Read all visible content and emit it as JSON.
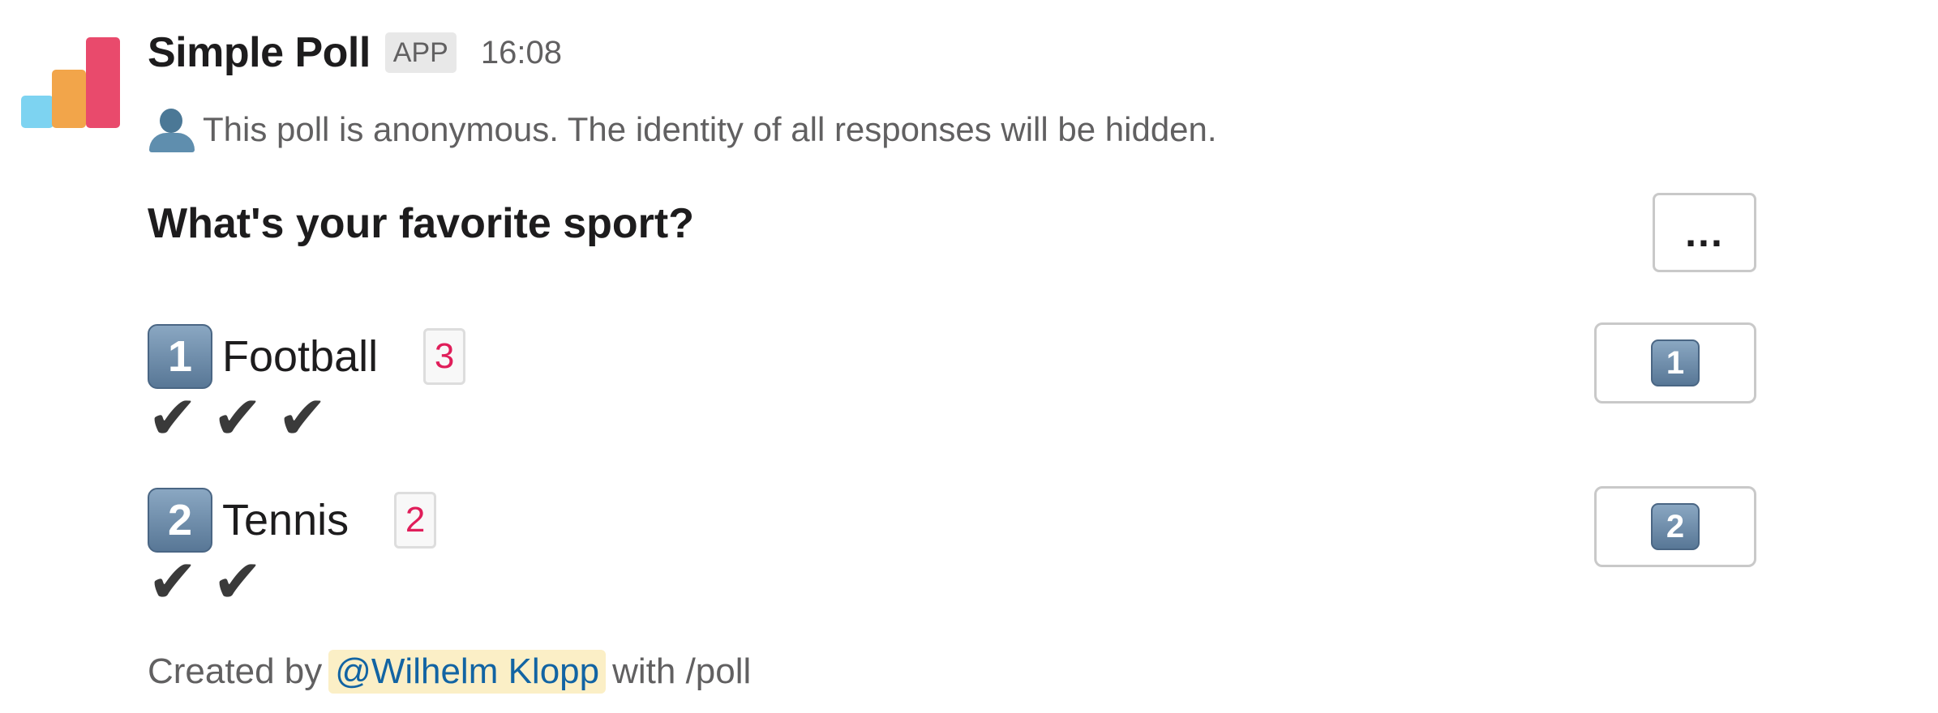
{
  "app": {
    "name": "Simple Poll",
    "badge": "APP",
    "timestamp": "16:08",
    "logo_colors": [
      "#7dd3f1",
      "#f2a54a",
      "#e94a6c"
    ]
  },
  "notice": {
    "icon": "bust-in-silhouette-icon",
    "text": "This poll is anonymous. The identity of all responses will be hidden."
  },
  "poll": {
    "question": "What's your favorite sport?",
    "more_button_label": "...",
    "options": [
      {
        "number": "1",
        "label": "Football",
        "count": "3",
        "checks": [
          "✔",
          "✔",
          "✔"
        ],
        "vote_button": "1"
      },
      {
        "number": "2",
        "label": "Tennis",
        "count": "2",
        "checks": [
          "✔",
          "✔"
        ],
        "vote_button": "2"
      }
    ]
  },
  "footer": {
    "prefix": "Created by",
    "mention": "@Wilhelm Klopp",
    "suffix": "with /poll"
  },
  "colors": {
    "count_text": "#e01e5a",
    "mention_bg": "#fbefc6",
    "mention_text": "#1264a3"
  }
}
